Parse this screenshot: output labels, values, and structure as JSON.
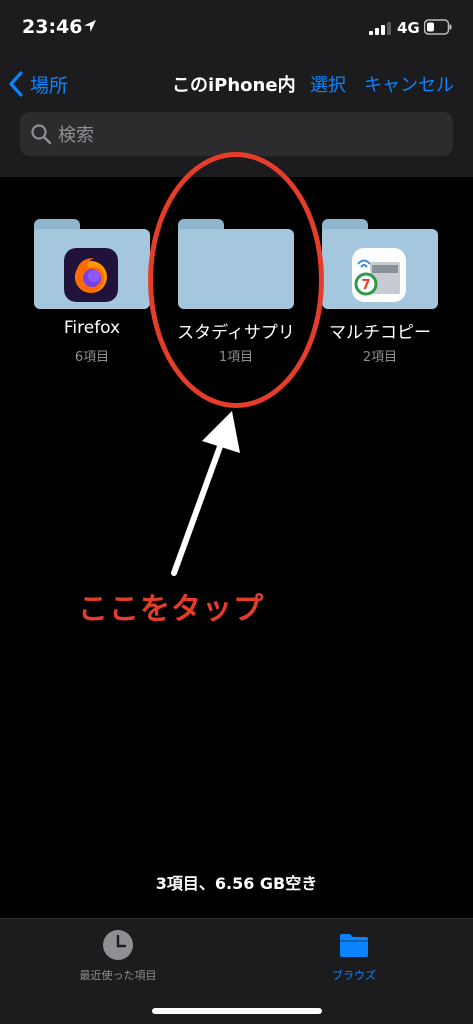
{
  "status_bar": {
    "time": "23:46",
    "network": "4G",
    "location_icon": "location-arrow-icon",
    "signal_icon": "signal-bars-icon",
    "battery_icon": "battery-icon"
  },
  "nav": {
    "back_label": "場所",
    "title": "このiPhone内",
    "select_label": "選択",
    "cancel_label": "キャンセル"
  },
  "search": {
    "placeholder": "検索"
  },
  "folders": [
    {
      "name": "Firefox",
      "count": "6項目",
      "icon": "firefox-app-icon"
    },
    {
      "name": "スタディサプリ",
      "count": "1項目",
      "icon": ""
    },
    {
      "name": "マルチコピー",
      "count": "2項目",
      "icon": "multicopy-app-icon"
    }
  ],
  "annotation": {
    "text": "ここをタップ",
    "color": "#e53d2a"
  },
  "storage_info": "3項目、6.56 GB空き",
  "tabbar": {
    "recent_label": "最近使った項目",
    "browse_label": "ブラウズ"
  },
  "colors": {
    "accent": "#0a84ff",
    "folder": "#a5c7de",
    "annotation": "#e53d2a"
  }
}
